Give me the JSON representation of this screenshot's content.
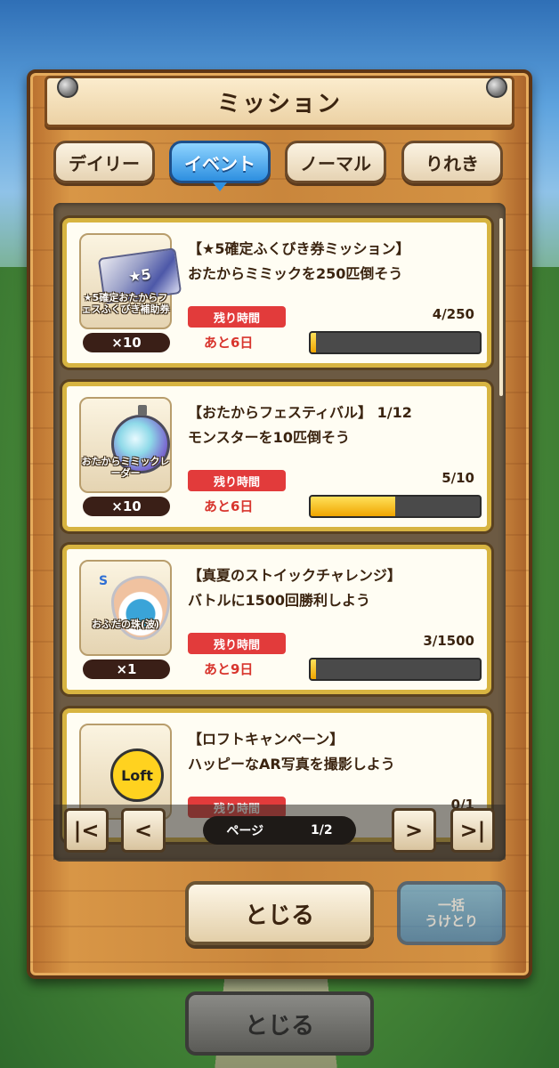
{
  "title": "ミッション",
  "tabs": [
    {
      "label": "デイリー",
      "active": false
    },
    {
      "label": "イベント",
      "active": true
    },
    {
      "label": "ノーマル",
      "active": false
    },
    {
      "label": "りれき",
      "active": false
    }
  ],
  "missions": [
    {
      "title": "【★5確定ふくびき券ミッション】",
      "description": "おたからミミックを250匹倒そう",
      "time_label": "残り時間",
      "remaining": "あと6日",
      "progress_text": "4/250",
      "progress": 0.016,
      "reward": {
        "name": "★5確定おたからフェスふくびき補助券",
        "quantity": "×10",
        "icon": "ticket-icon",
        "icon_text": "★5"
      }
    },
    {
      "title": "【おたからフェスティバル】 1/12",
      "description": "モンスターを10匹倒そう",
      "time_label": "残り時間",
      "remaining": "あと6日",
      "progress_text": "5/10",
      "progress": 0.5,
      "reward": {
        "name": "おたからミミックレーダー",
        "quantity": "×10",
        "icon": "radar-icon"
      }
    },
    {
      "title": "【真夏のストイックチャレンジ】",
      "description": "バトルに1500回勝利しよう",
      "time_label": "残り時間",
      "remaining": "あと9日",
      "progress_text": "3/1500",
      "progress": 0.002,
      "reward": {
        "name": "おふだの珠(波)",
        "quantity": "×1",
        "icon": "orb-icon",
        "icon_text": "S"
      }
    },
    {
      "title": "【ロフトキャンペーン】",
      "description": "ハッピーなAR写真を撮影しよう",
      "time_label": "残り時間",
      "remaining": "",
      "progress_text": "0/1",
      "progress": 0,
      "reward": {
        "name": "",
        "quantity": "",
        "icon": "loft-icon",
        "icon_text": "Loft"
      }
    }
  ],
  "pagination": {
    "label": "ページ",
    "current": "1/2"
  },
  "buttons": {
    "close": "とじる",
    "collect_all_line1": "一括",
    "collect_all_line2": "うけとり",
    "outer_close": "とじる"
  },
  "colors": {
    "accent": "#2d8fe0",
    "time_badge": "#e23b3b",
    "progress_fill": "#f0a500",
    "card_border": "#d7b441"
  }
}
